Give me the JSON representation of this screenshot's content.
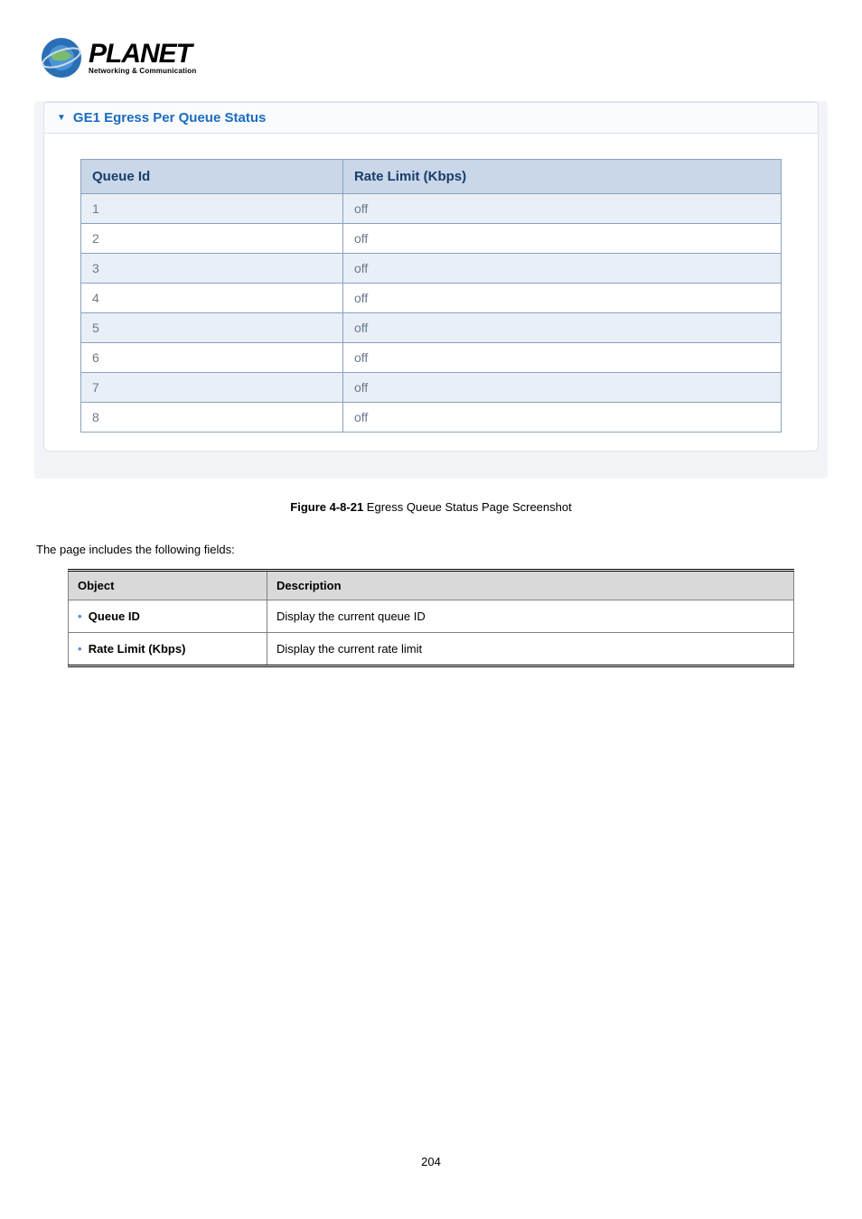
{
  "logo": {
    "main": "PLANET",
    "sub": "Networking & Communication"
  },
  "panel": {
    "title": "GE1 Egress Per Queue Status",
    "headers": {
      "queue": "Queue Id",
      "rate": "Rate Limit (Kbps)"
    },
    "rows": [
      {
        "id": "1",
        "rate": "off"
      },
      {
        "id": "2",
        "rate": "off"
      },
      {
        "id": "3",
        "rate": "off"
      },
      {
        "id": "4",
        "rate": "off"
      },
      {
        "id": "5",
        "rate": "off"
      },
      {
        "id": "6",
        "rate": "off"
      },
      {
        "id": "7",
        "rate": "off"
      },
      {
        "id": "8",
        "rate": "off"
      }
    ]
  },
  "figure": {
    "label": "Figure 4-8-21",
    "text": " Egress Queue Status Page Screenshot"
  },
  "paragraph": "The page includes the following fields:",
  "fields": {
    "headers": {
      "object": "Object",
      "description": "Description"
    },
    "rows": [
      {
        "object": "Queue ID",
        "description": "Display the current queue ID"
      },
      {
        "object": "Rate Limit (Kbps)",
        "description": "Display the current rate limit"
      }
    ]
  },
  "page_number": "204"
}
